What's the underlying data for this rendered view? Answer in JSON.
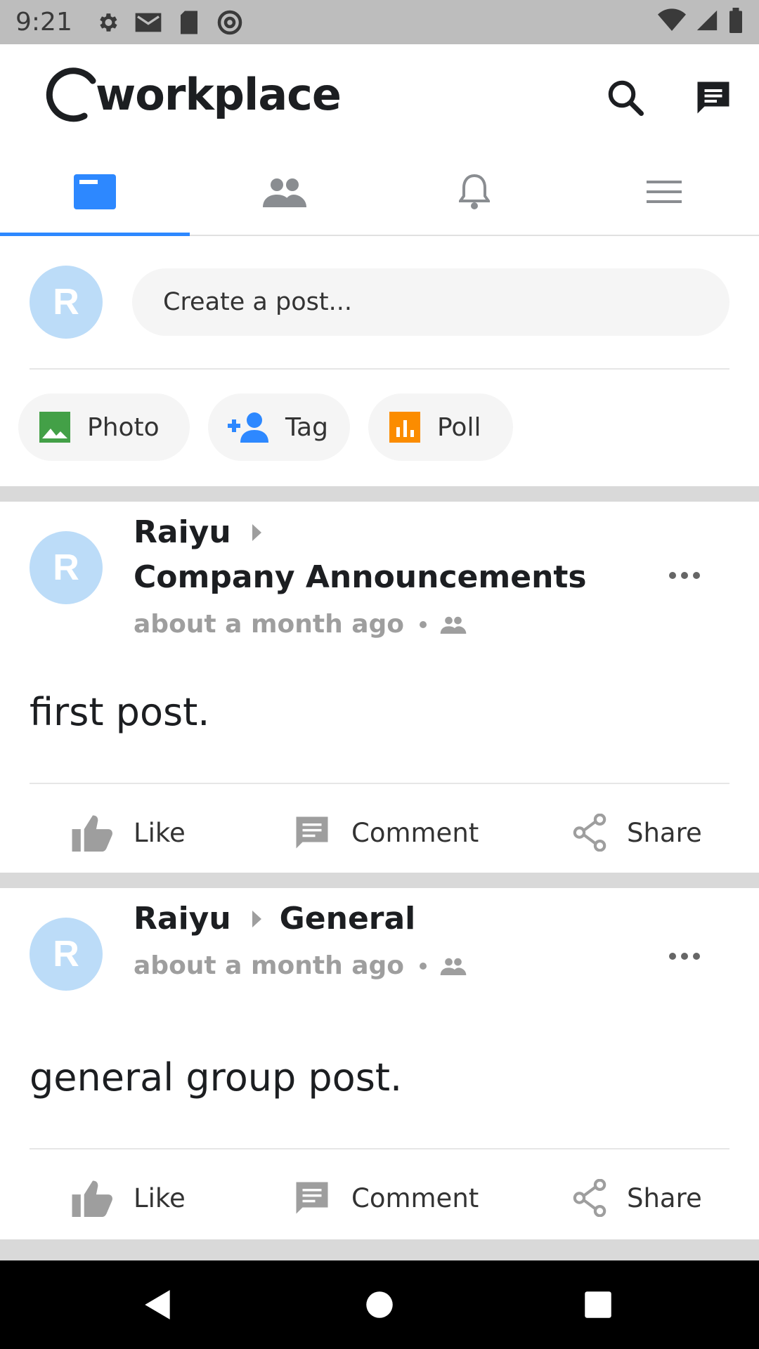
{
  "status_bar": {
    "time": "9:21"
  },
  "app": {
    "name": "workplace"
  },
  "tabs": [
    {
      "name": "News Feed"
    },
    {
      "name": "Groups"
    },
    {
      "name": "Notifications"
    },
    {
      "name": "Menu"
    }
  ],
  "composer": {
    "avatar_initial": "R",
    "placeholder": "Create a post...",
    "chips": {
      "photo": "Photo",
      "tag": "Tag",
      "poll": "Poll"
    }
  },
  "posts": [
    {
      "avatar_initial": "R",
      "author": "Raiyu",
      "group": "Company Announcements",
      "time": "about a month ago",
      "text": "first post.",
      "actions": {
        "like": "Like",
        "comment": "Comment",
        "share": "Share"
      }
    },
    {
      "avatar_initial": "R",
      "author": "Raiyu",
      "group": "General",
      "time": "about a month ago",
      "text": "general group post.",
      "actions": {
        "like": "Like",
        "comment": "Comment",
        "share": "Share"
      }
    }
  ],
  "colors": {
    "accent": "#2d88ff",
    "avatar": "#bcdcf8",
    "photo": "#43a047",
    "tag": "#2d88ff",
    "poll": "#fb8c00"
  }
}
